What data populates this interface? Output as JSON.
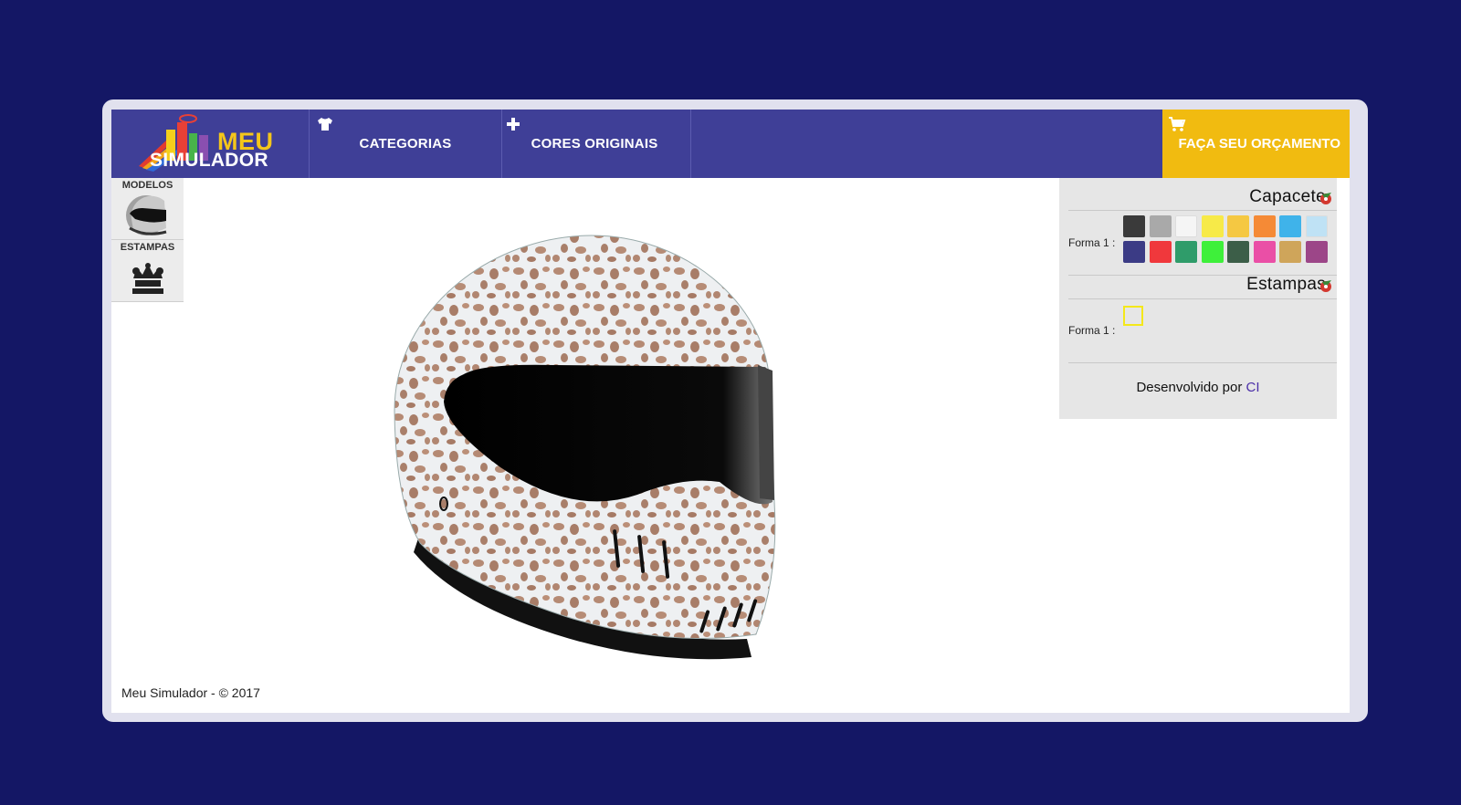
{
  "logo": {
    "line1": "MEU",
    "line2": "SIMULADOR"
  },
  "nav": {
    "items": [
      {
        "label": "CATEGORIAS",
        "icon": "shirt-icon"
      },
      {
        "label": "CORES ORIGINAIS",
        "icon": "plus-icon"
      }
    ],
    "quote": {
      "label": "FAÇA SEU ORÇAMENTO",
      "icon": "cart-icon"
    }
  },
  "sidebar": {
    "tabs": [
      {
        "label": "MODELOS",
        "icon": "helmet-icon"
      },
      {
        "label": "ESTAMPAS",
        "icon": "crown-icon"
      }
    ]
  },
  "panel": {
    "capacete": {
      "title": "Capacete",
      "forma_label": "Forma 1 :",
      "colors": [
        "#3a3a3a",
        "#a9a9a9",
        "#f5f5f5",
        "#f7ea48",
        "#f5c842",
        "#f58a36",
        "#3fb3ea",
        "#bfe2f5",
        "#3b3b85",
        "#f0383c",
        "#2f9c6a",
        "#3ef03a",
        "#3c5e48",
        "#ea4fa6",
        "#cfa55a",
        "#9c4688"
      ]
    },
    "estampas": {
      "title": "Estampas",
      "forma_label": "Forma 1 :",
      "selected_color": "#f4e81a"
    },
    "developed_by": "Desenvolvido por",
    "developer": "CI"
  },
  "footer": "Meu Simulador - © 2017",
  "colors": {
    "background": "#141765",
    "nav": "#3f3f97",
    "quote": "#f1bb10",
    "panel": "#e6e6e6"
  }
}
